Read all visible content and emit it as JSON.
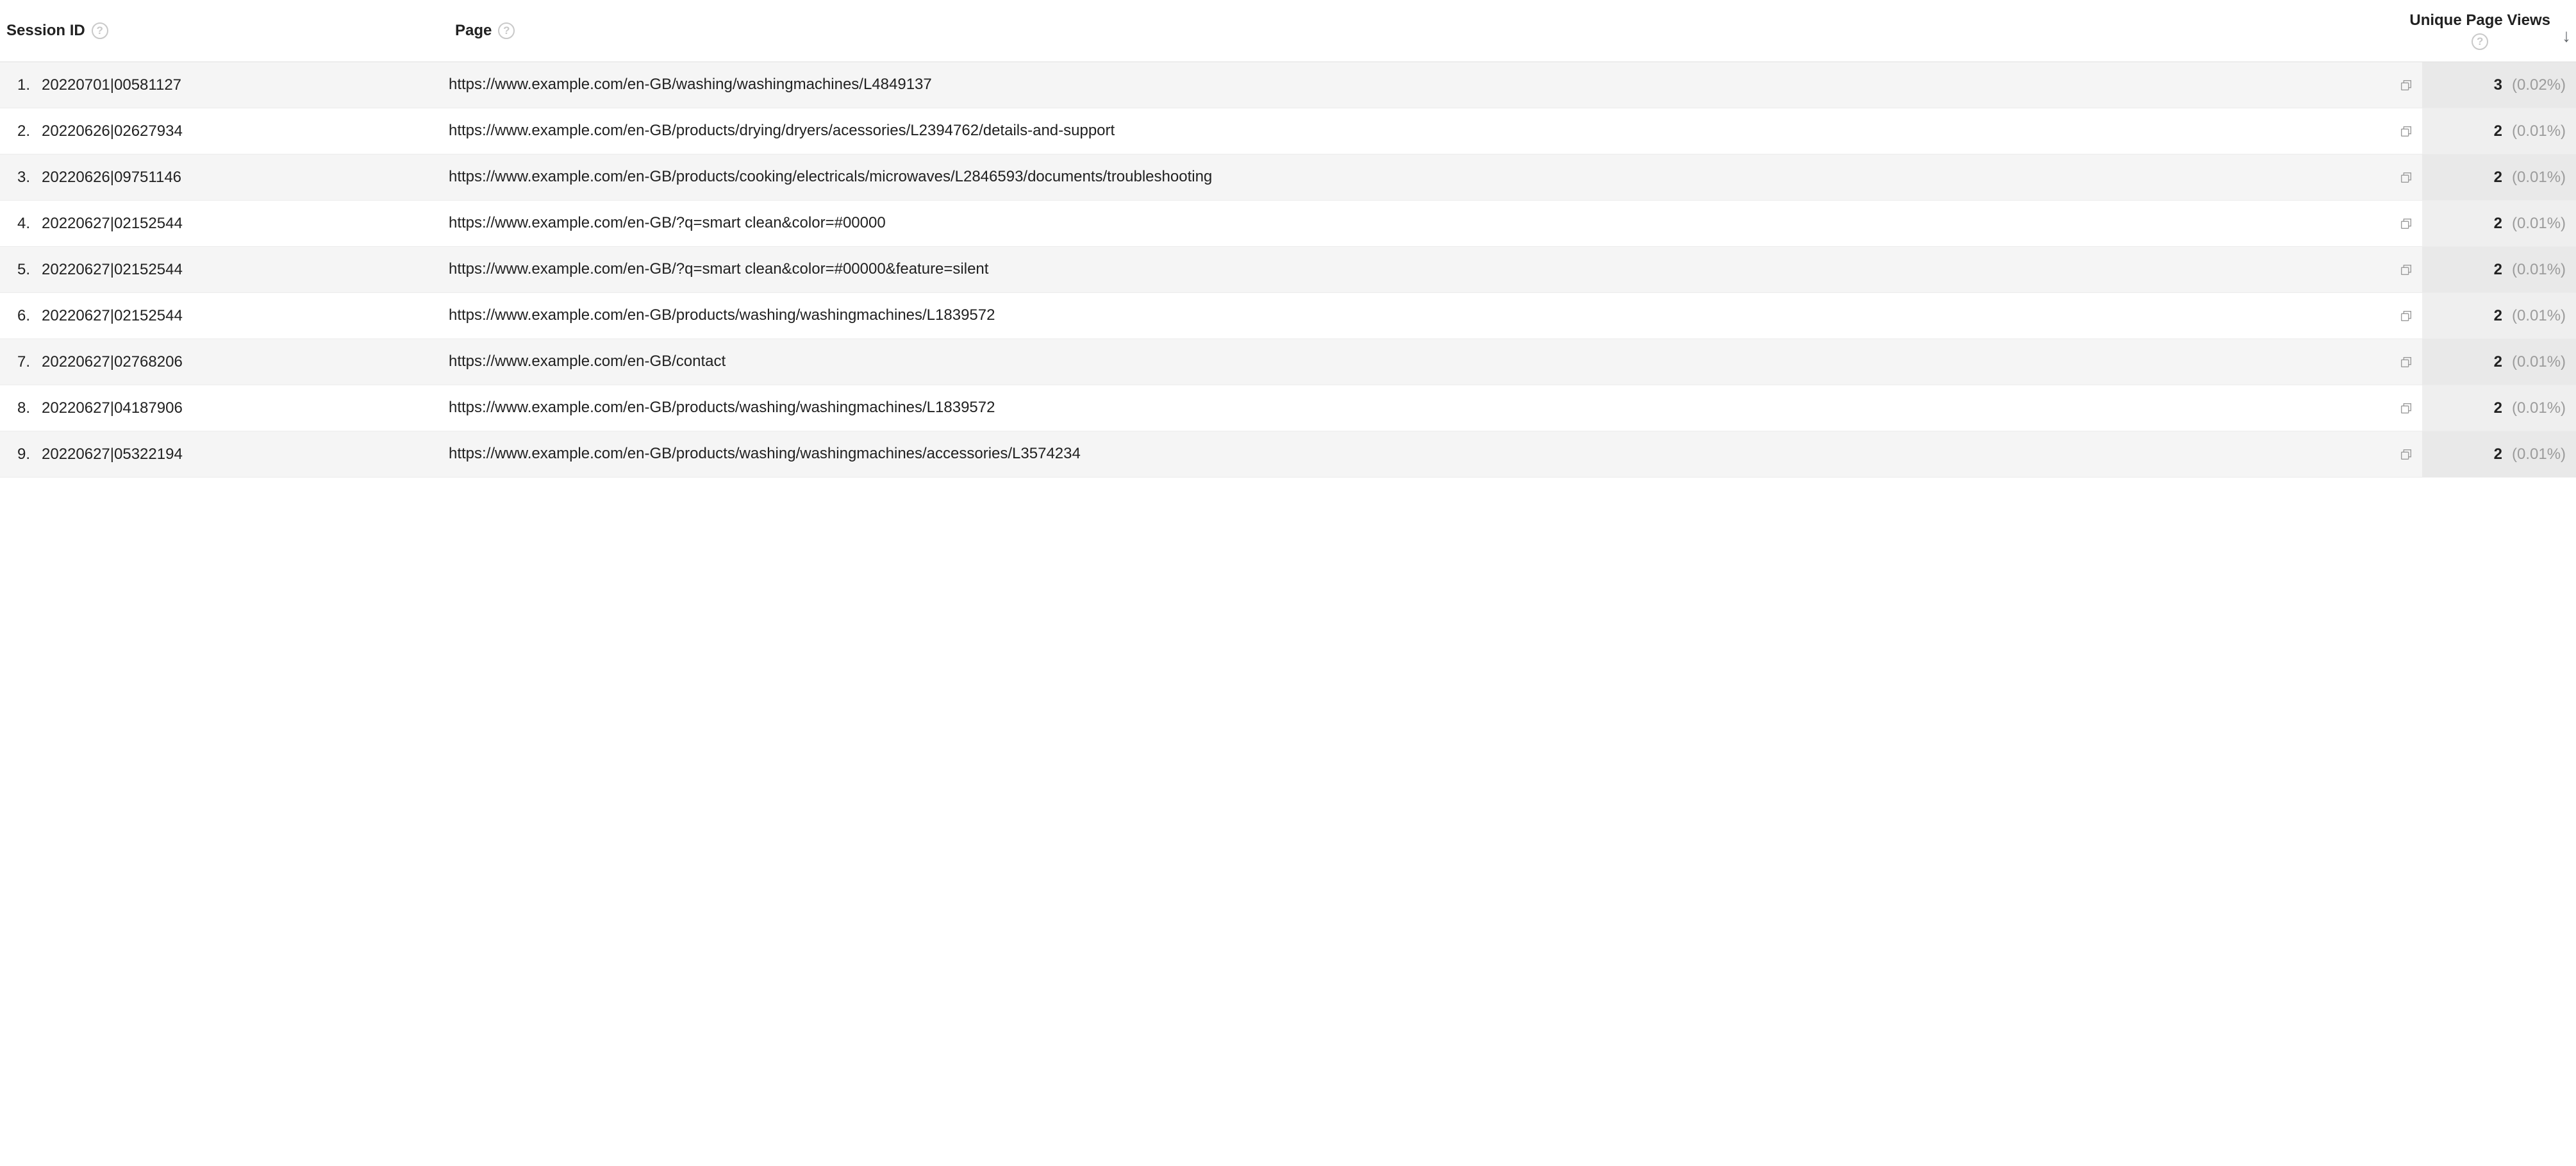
{
  "headers": {
    "session_id": "Session ID",
    "page": "Page",
    "unique_page_views": "Unique Page Views"
  },
  "rows": [
    {
      "index": "1.",
      "session_id": "20220701|00581127",
      "page": "https://www.example.com/en-GB/washing/washingmachines/L4849137",
      "views": "3",
      "pct": "(0.02%)"
    },
    {
      "index": "2.",
      "session_id": "20220626|02627934",
      "page": "https://www.example.com/en-GB/products/drying/dryers/acessories/L2394762/details-and-support",
      "views": "2",
      "pct": "(0.01%)"
    },
    {
      "index": "3.",
      "session_id": "20220626|09751146",
      "page": "https://www.example.com/en-GB/products/cooking/electricals/microwaves/L2846593/documents/troubleshooting",
      "views": "2",
      "pct": "(0.01%)"
    },
    {
      "index": "4.",
      "session_id": "20220627|02152544",
      "page": "https://www.example.com/en-GB/?q=smart clean&color=#00000",
      "views": "2",
      "pct": "(0.01%)"
    },
    {
      "index": "5.",
      "session_id": "20220627|02152544",
      "page": "https://www.example.com/en-GB/?q=smart clean&color=#00000&feature=silent",
      "views": "2",
      "pct": "(0.01%)"
    },
    {
      "index": "6.",
      "session_id": "20220627|02152544",
      "page": "https://www.example.com/en-GB/products/washing/washingmachines/L1839572",
      "views": "2",
      "pct": "(0.01%)"
    },
    {
      "index": "7.",
      "session_id": "20220627|02768206",
      "page": "https://www.example.com/en-GB/contact",
      "views": "2",
      "pct": "(0.01%)"
    },
    {
      "index": "8.",
      "session_id": "20220627|04187906",
      "page": "https://www.example.com/en-GB/products/washing/washingmachines/L1839572",
      "views": "2",
      "pct": "(0.01%)"
    },
    {
      "index": "9.",
      "session_id": "20220627|05322194",
      "page": "https://www.example.com/en-GB/products/washing/washingmachines/accessories/L3574234",
      "views": "2",
      "pct": "(0.01%)"
    }
  ]
}
